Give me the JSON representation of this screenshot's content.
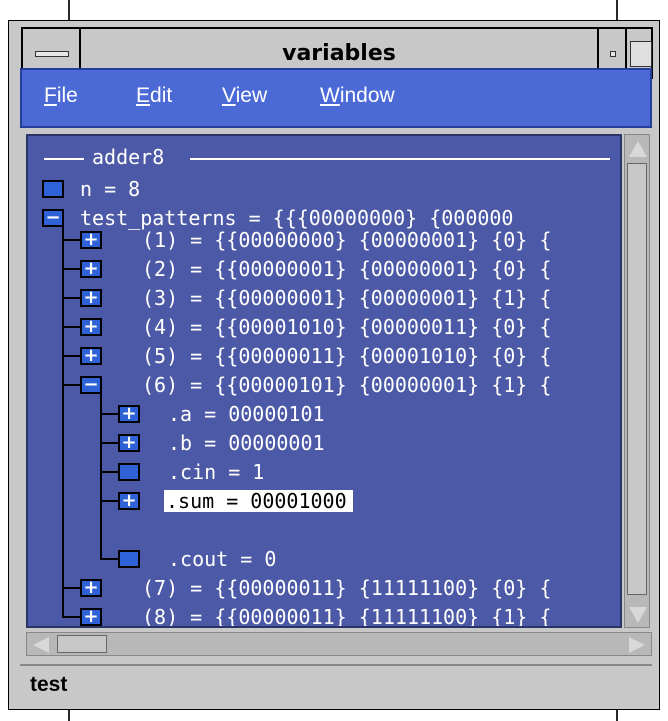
{
  "window": {
    "title": "variables"
  },
  "menu": [
    {
      "label": "File",
      "mnemonic": "F",
      "rest": "ile"
    },
    {
      "label": "Edit",
      "mnemonic": "E",
      "rest": "dit"
    },
    {
      "label": "View",
      "mnemonic": "V",
      "rest": "iew"
    },
    {
      "label": "Window",
      "mnemonic": "W",
      "rest": "indow"
    }
  ],
  "tree": {
    "group_label": "adder8",
    "rows": [
      {
        "text": "n = 8",
        "expander": "none"
      },
      {
        "text": "test_patterns = {{{00000000} {000000",
        "expander": "minus"
      },
      {
        "text": "(1) = {{00000000} {00000001} {0} {",
        "expander": "plus"
      },
      {
        "text": "(2) = {{00000001} {00000001} {0} {",
        "expander": "plus"
      },
      {
        "text": "(3) = {{00000001} {00000001} {1} {",
        "expander": "plus"
      },
      {
        "text": "(4) = {{00001010} {00000011} {0} {",
        "expander": "plus"
      },
      {
        "text": "(5) = {{00000011} {00001010} {0} {",
        "expander": "plus"
      },
      {
        "text": "(6) = {{00000101} {00000001} {1} {",
        "expander": "minus"
      },
      {
        "text": ".a = 00000101",
        "expander": "plus"
      },
      {
        "text": ".b = 00000001",
        "expander": "plus"
      },
      {
        "text": ".cin = 1",
        "expander": "none"
      },
      {
        "text": ".sum = 00001000",
        "expander": "plus",
        "selected": true
      },
      {
        "text": ".cout = 0",
        "expander": "none"
      },
      {
        "text": "(7) = {{00000011} {11111100} {0} {",
        "expander": "plus"
      },
      {
        "text": "(8) = {{00000011} {11111100} {1} {",
        "expander": "plus"
      }
    ]
  },
  "status": {
    "text": "test"
  }
}
